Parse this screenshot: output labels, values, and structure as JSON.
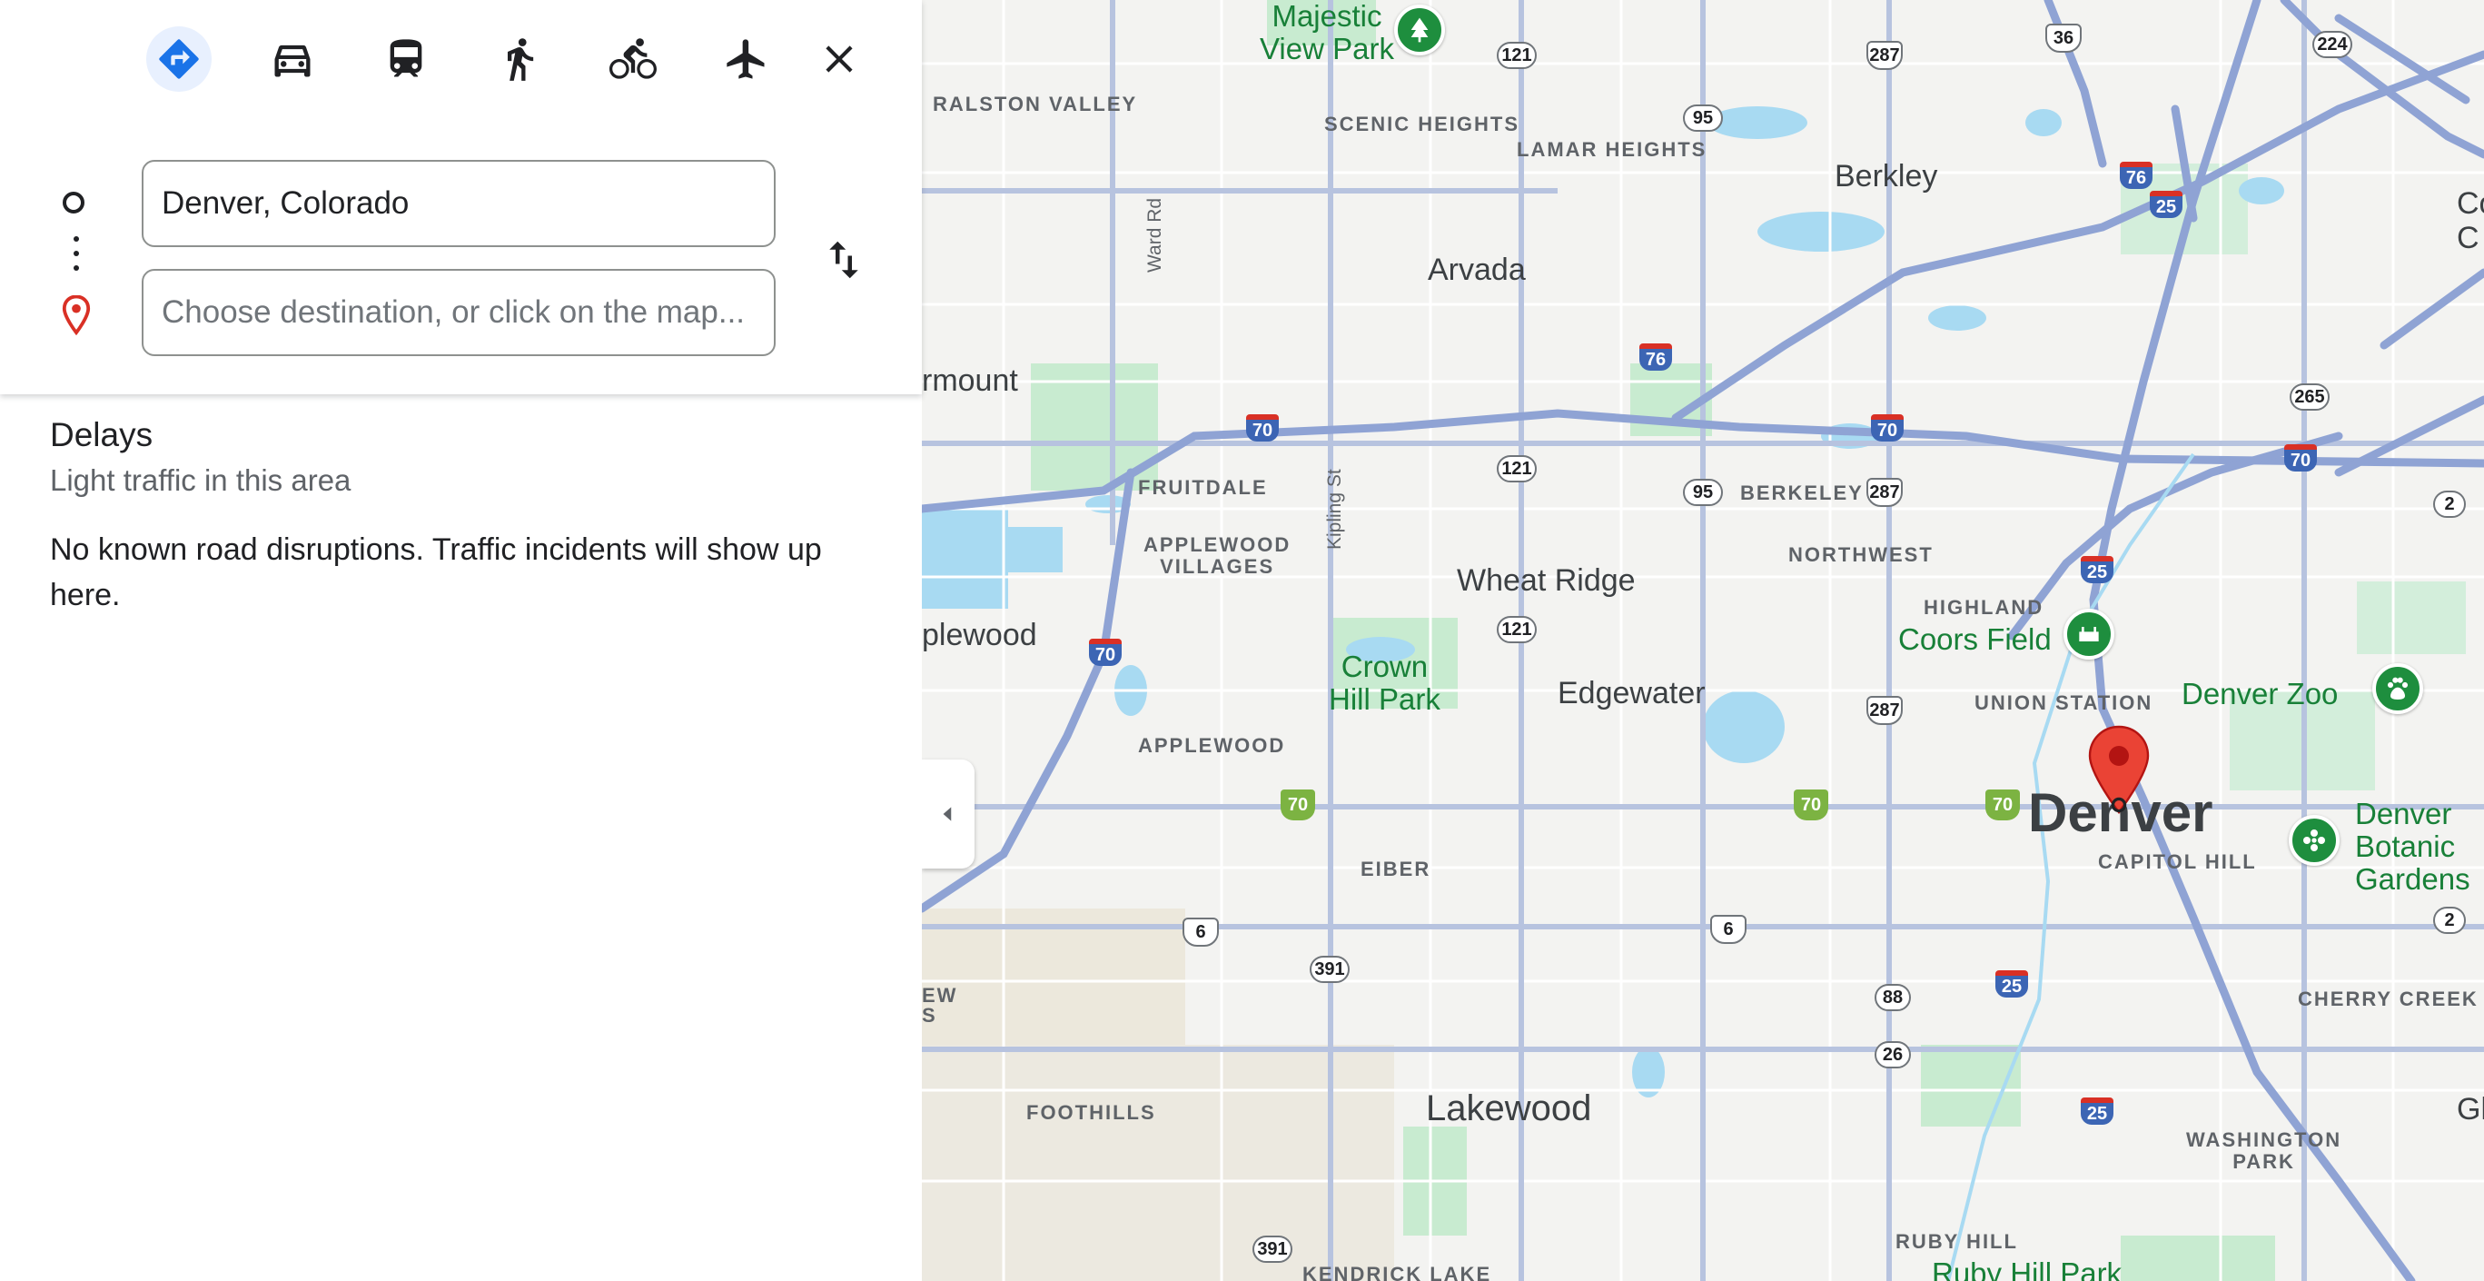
{
  "travel_modes": [
    {
      "id": "best",
      "label": "Best travel modes",
      "active": true
    },
    {
      "id": "driving",
      "label": "Driving"
    },
    {
      "id": "transit",
      "label": "Transit"
    },
    {
      "id": "walking",
      "label": "Walking"
    },
    {
      "id": "cycling",
      "label": "Cycling"
    },
    {
      "id": "flights",
      "label": "Flights"
    }
  ],
  "directions": {
    "origin_value": "Denver, Colorado",
    "destination_placeholder": "Choose destination, or click on the map..."
  },
  "delays": {
    "title": "Delays",
    "subtitle": "Light traffic in this area",
    "body": "No known road disruptions. Traffic incidents will show up here."
  },
  "map": {
    "labels": {
      "majestic_view_park": "Majestic\nView Park",
      "ralston_valley": "RALSTON VALLEY",
      "scenic_heights": "SCENIC HEIGHTS",
      "lamar_heights": "LAMAR HEIGHTS",
      "berkley": "Berkley",
      "commerce_city": "Com\nC",
      "arvada": "Arvada",
      "ward_rd": "Ward Rd",
      "westminster_partial": "rmount",
      "fruitdale": "FRUITDALE",
      "kipling_st": "Kipling St",
      "berkeley": "BERKELEY",
      "applewood_villages": "APPLEWOOD\nVILLAGES",
      "northwest": "NORTHWEST",
      "wheat_ridge": "Wheat Ridge",
      "highland": "HIGHLAND",
      "lakewood_partial": "plewood",
      "coors_field": "Coors Field",
      "crown_hill_park": "Crown\nHill Park",
      "edgewater": "Edgewater",
      "union_station": "UNION STATION",
      "denver_zoo": "Denver Zoo",
      "applewood": "APPLEWOOD",
      "denver": "Denver",
      "denver_botanic_gardens": "Denver\nBotanic\nGardens",
      "capitol_hill": "CAPITOL HILL",
      "eiber": "EIBER",
      "cherry_creek": "CHERRY CREEK",
      "ew_partial": "EW\nS",
      "lakewood": "Lakewood",
      "foothills": "FOOTHILLS",
      "washington_park": "WASHINGTON\nPARK",
      "glen_partial": "Gle",
      "ruby_hill": "RUBY HILL",
      "ruby_hill_park": "Ruby Hill Park",
      "kendrick_lake": "KENDRICK LAKE"
    },
    "shields": {
      "i70_a": "70",
      "i70_b": "70",
      "i70_c": "70",
      "i70_d": "70",
      "i76_a": "76",
      "i76_b": "76",
      "i25_a": "25",
      "i25_b": "25",
      "i25_c": "25",
      "i25_d": "25",
      "us36": "36",
      "us287_a": "287",
      "us287_b": "287",
      "us287_c": "287",
      "us6_a": "6",
      "us6_b": "6",
      "sr121_a": "121",
      "sr121_b": "121",
      "sr121_c": "121",
      "sr95_a": "95",
      "sr95_b": "95",
      "sr224": "224",
      "sr265": "265",
      "sr2_a": "2",
      "sr2_b": "2",
      "sr391_a": "391",
      "sr391_b": "391",
      "sr88": "88",
      "sr26": "26",
      "g70_a": "70",
      "g70_b": "70",
      "g70_c": "70"
    }
  },
  "colors": {
    "accent": "#1a73e8",
    "pin": "#ea4335",
    "poi_green": "#1e8e3e",
    "interstate_blue": "#3c65b4"
  }
}
